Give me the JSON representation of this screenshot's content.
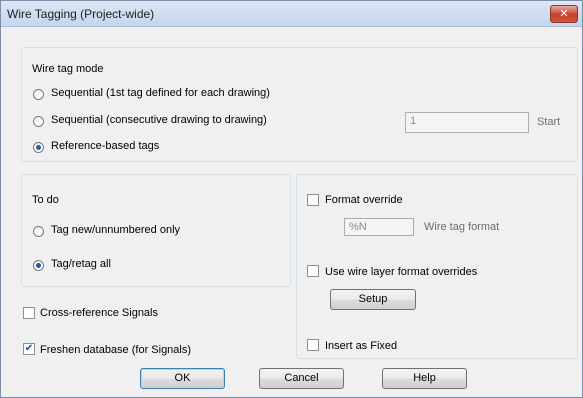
{
  "window": {
    "title": "Wire Tagging (Project-wide)",
    "close_glyph": "✕"
  },
  "mode_group": {
    "heading": "Wire tag mode",
    "options": [
      {
        "label": "Sequential (1st tag defined for each drawing)",
        "selected": false
      },
      {
        "label": "Sequential (consecutive drawing to drawing)",
        "selected": false
      },
      {
        "label": "Reference-based tags",
        "selected": true
      }
    ],
    "start_value": "1",
    "start_label": "Start"
  },
  "todo_group": {
    "heading": "To do",
    "options": [
      {
        "label": "Tag new/unnumbered only",
        "selected": false
      },
      {
        "label": "Tag/retag all",
        "selected": true
      }
    ]
  },
  "format_group": {
    "format_override_label": "Format override",
    "format_override_checked": false,
    "format_value": "%N",
    "format_caption": "Wire tag format",
    "layer_override_label": "Use wire layer format overrides",
    "layer_override_checked": false,
    "setup_label": "Setup",
    "insert_fixed_label": "Insert as Fixed",
    "insert_fixed_checked": false
  },
  "options": {
    "cross_ref_label": "Cross-reference Signals",
    "cross_ref_checked": false,
    "freshen_label": "Freshen database (for Signals)",
    "freshen_checked": true,
    "check_glyph": "✔"
  },
  "buttons": {
    "ok": "OK",
    "cancel": "Cancel",
    "help": "Help"
  }
}
